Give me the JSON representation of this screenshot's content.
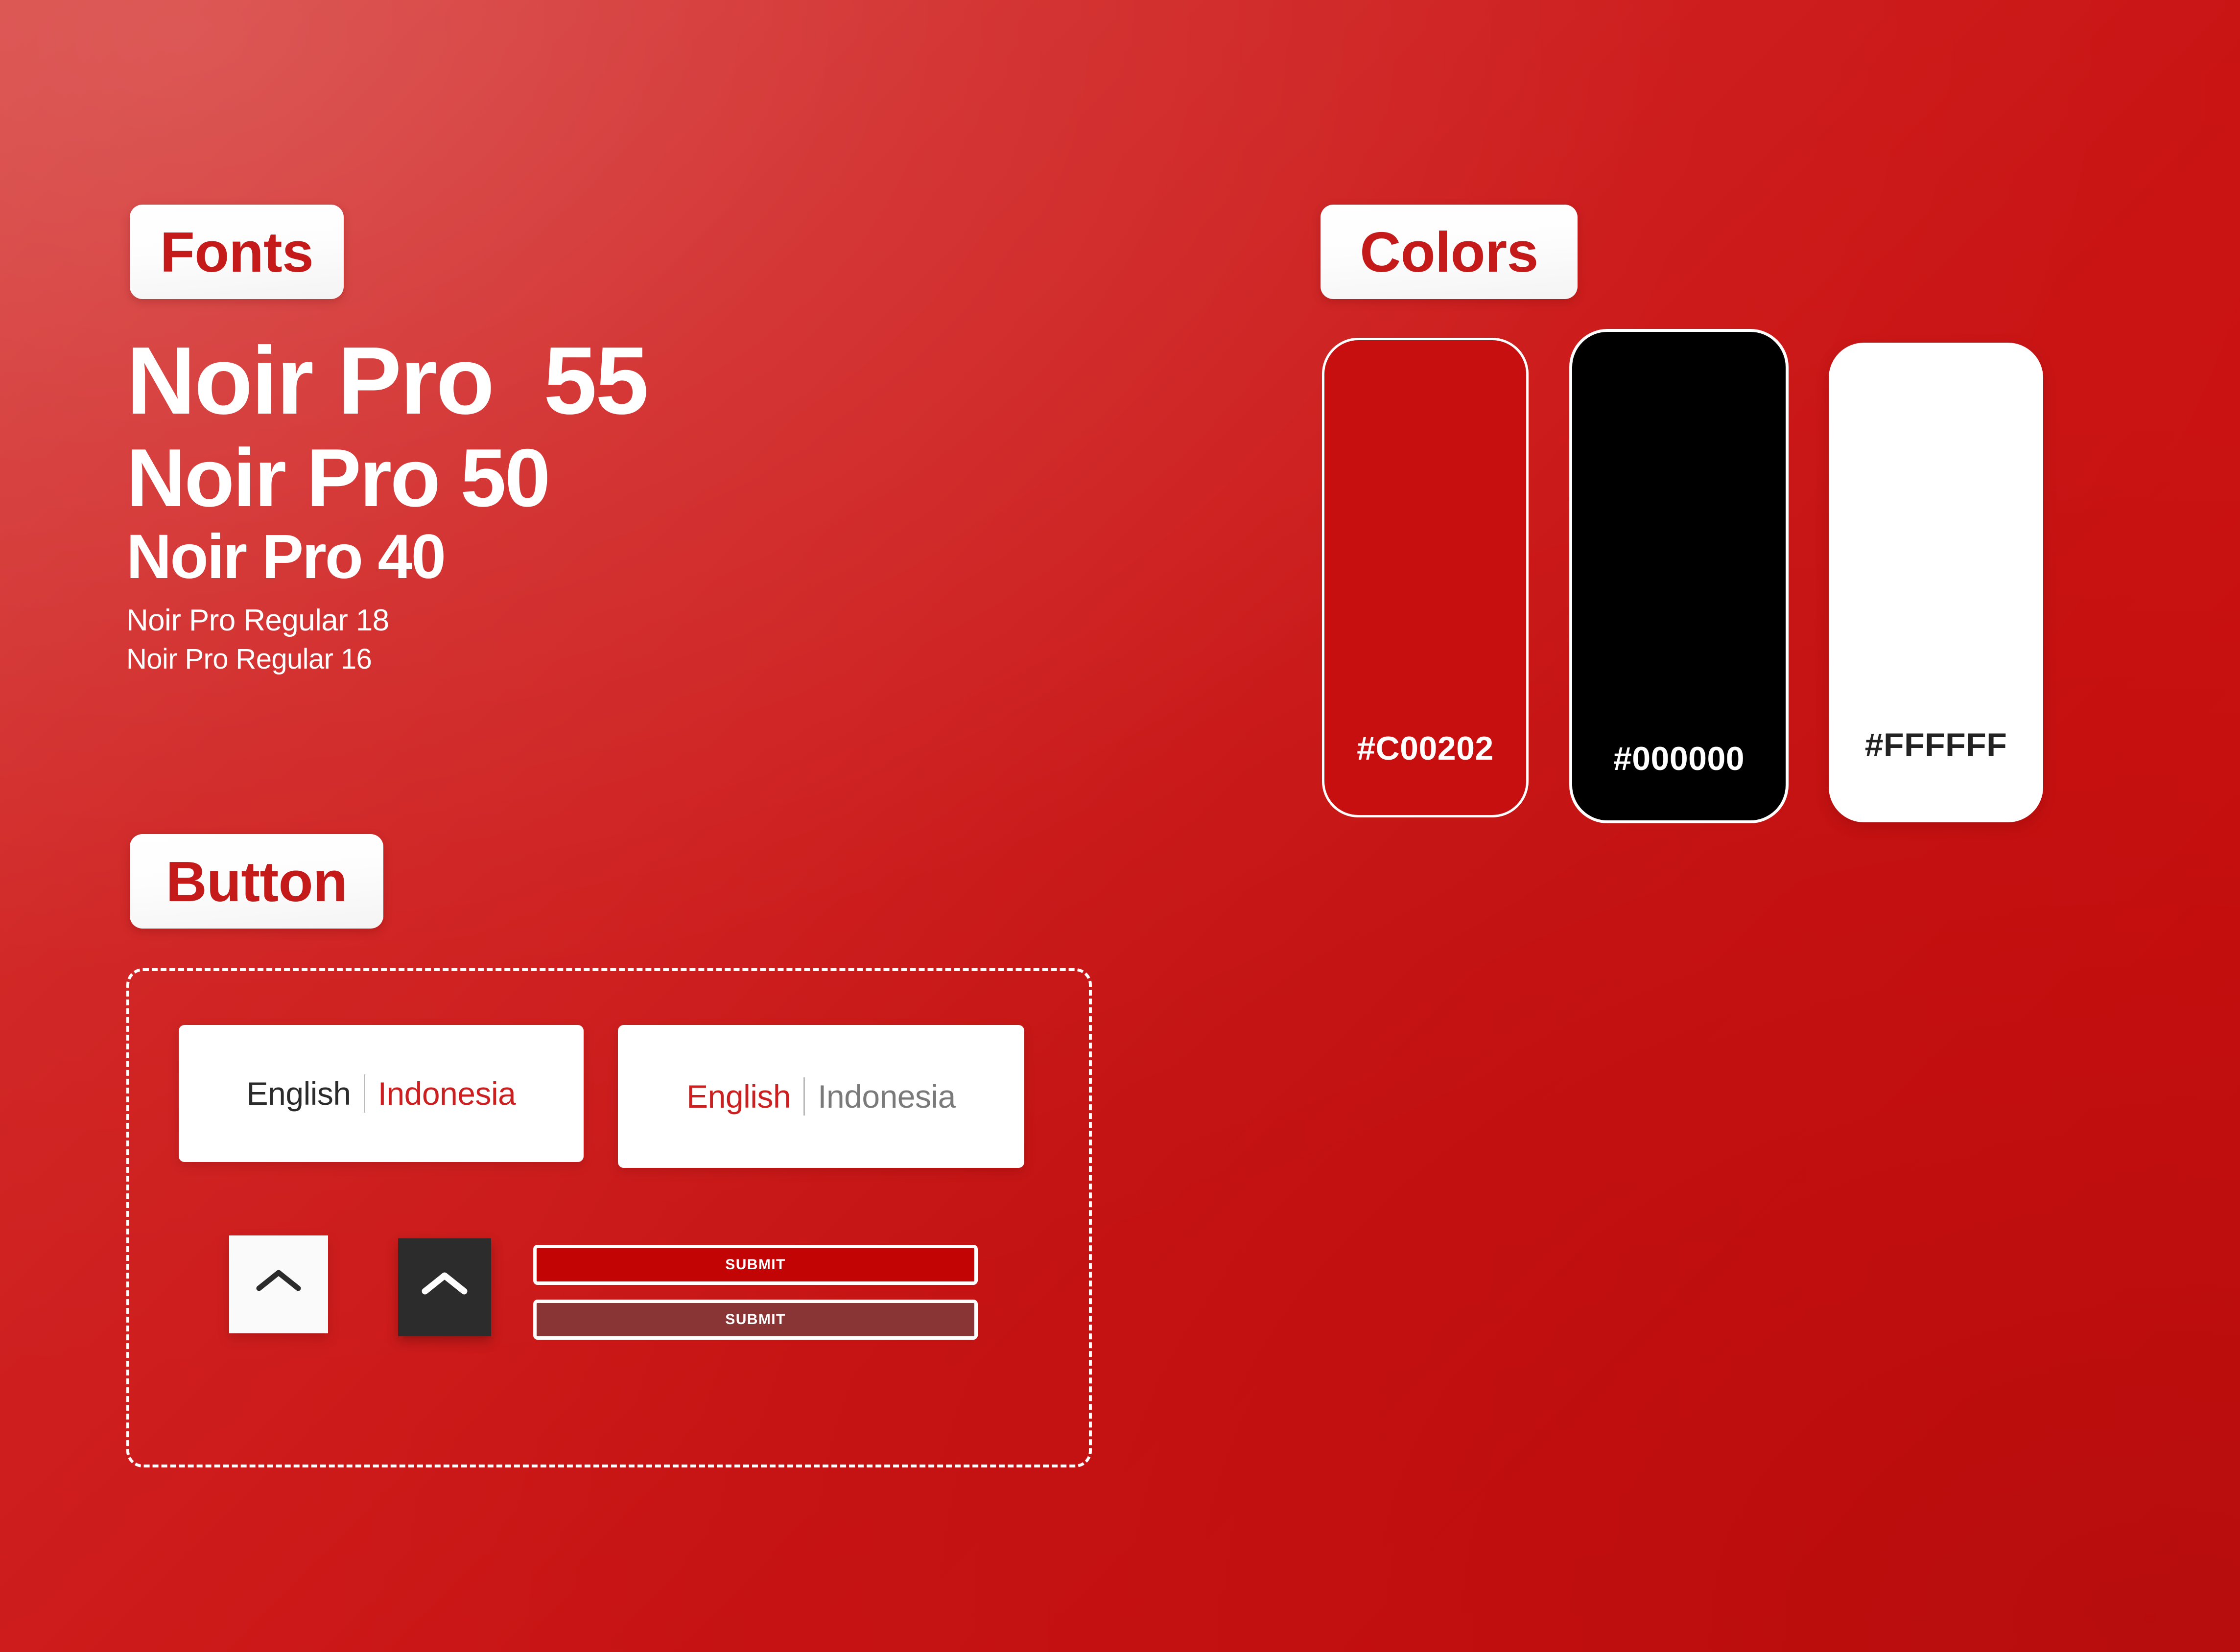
{
  "page": {
    "background_color_start": "#D63B38",
    "background_color_end": "#C91010"
  },
  "fonts_section": {
    "badge_label": "Fonts",
    "specimens": [
      {
        "text": "Noir Pro  55",
        "size_label": "55"
      },
      {
        "text": "Noir Pro 50",
        "size_label": "50"
      },
      {
        "text": "Noir Pro 40",
        "size_label": "40"
      },
      {
        "text": "Noir Pro Regular 18",
        "size_label": "18"
      },
      {
        "text": "Noir Pro Regular 16",
        "size_label": "16"
      }
    ]
  },
  "colors_section": {
    "badge_label": "Colors",
    "swatches": [
      {
        "hex": "#C00202",
        "fill": "#C80F0F",
        "label_color": "#FFFFFF",
        "name": "brand-red"
      },
      {
        "hex": "#000000",
        "fill": "#000000",
        "label_color": "#FFFFFF",
        "name": "black"
      },
      {
        "hex": "#FFFFFF",
        "fill": "#FFFFFF",
        "label_color": "#222222",
        "name": "white"
      }
    ]
  },
  "button_section": {
    "badge_label": "Button",
    "language_toggles": [
      {
        "left_label": "English",
        "right_label": "Indonesia",
        "active": "Indonesia",
        "left_color": "#2B2B2B",
        "right_color": "#CC1F1F"
      },
      {
        "left_label": "English",
        "right_label": "Indonesia",
        "active": "English",
        "left_color": "#CC1F1F",
        "right_color": "#7A7A7A"
      }
    ],
    "chevron_buttons": [
      {
        "icon": "chevron-up-icon",
        "background": "#FAFAFA",
        "glyph_color": "#2B2B2B",
        "state": "light"
      },
      {
        "icon": "chevron-up-icon",
        "background": "#2C2C2C",
        "glyph_color": "#FFFFFF",
        "state": "dark"
      }
    ],
    "submit_buttons": [
      {
        "label": "SUBMIT",
        "background": "#C20404",
        "state": "default"
      },
      {
        "label": "SUBMIT",
        "background": "#8A3535",
        "state": "disabled"
      }
    ]
  }
}
